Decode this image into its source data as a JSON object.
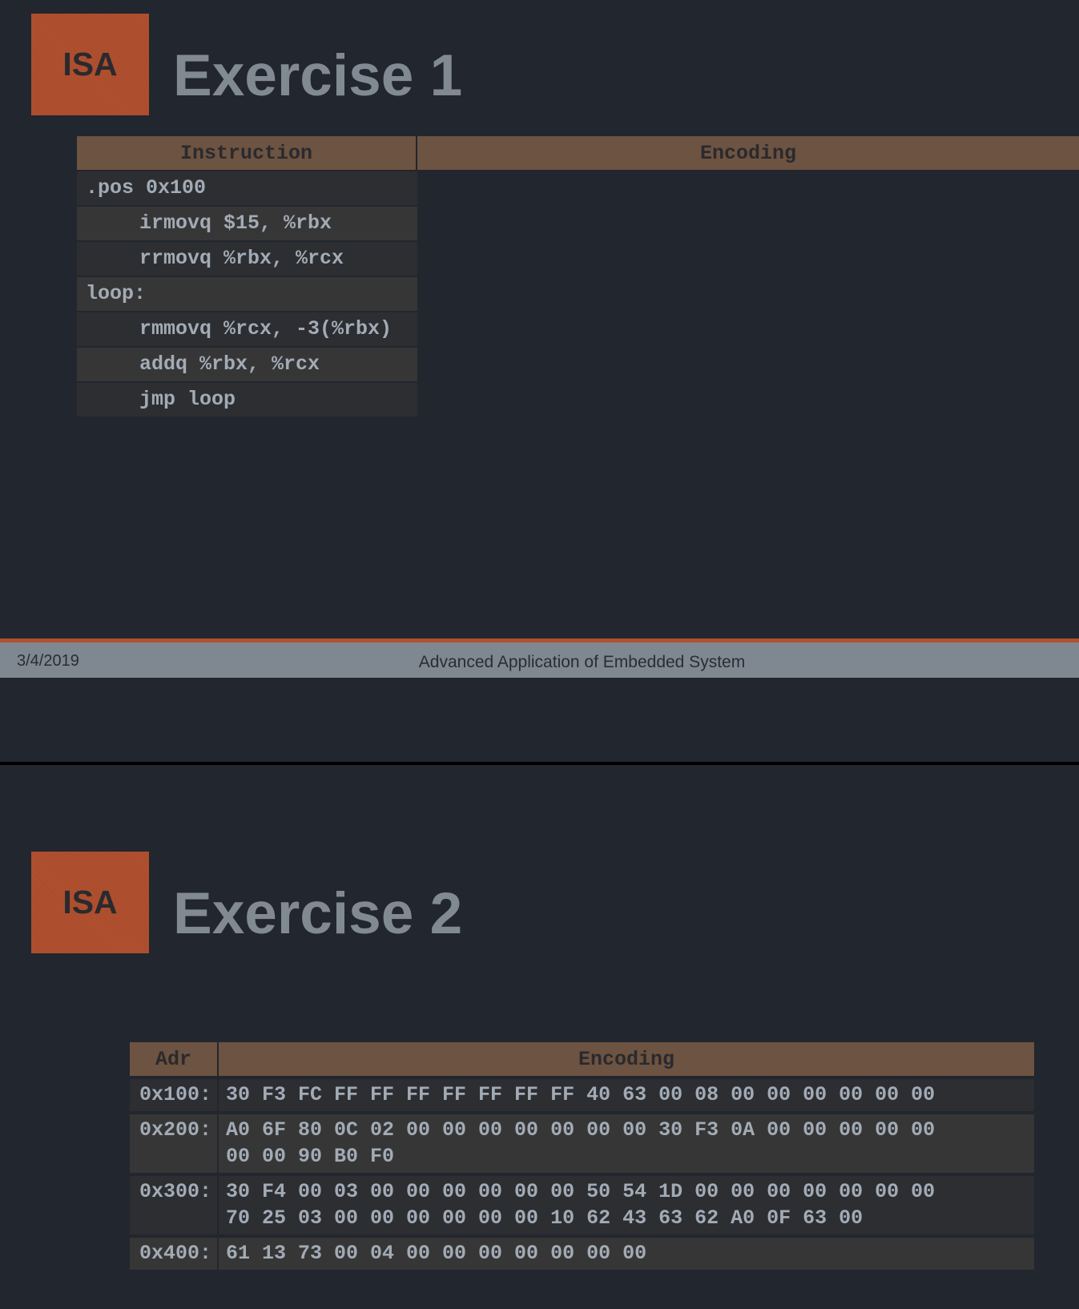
{
  "slide1": {
    "logo": "ISA",
    "title": "Exercise 1",
    "table": {
      "headers": [
        "Instruction",
        "Encoding"
      ],
      "rows": [
        {
          "instruction": ".pos 0x100",
          "encoding": ""
        },
        {
          "instruction": "irmovq $15, %rbx",
          "encoding": ""
        },
        {
          "instruction": "rrmovq %rbx, %rcx",
          "encoding": ""
        },
        {
          "instruction": "loop:",
          "encoding": ""
        },
        {
          "instruction": "rmmovq %rcx, -3(%rbx)",
          "encoding": ""
        },
        {
          "instruction": "addq %rbx, %rcx",
          "encoding": ""
        },
        {
          "instruction": "jmp loop",
          "encoding": ""
        }
      ]
    },
    "footer": {
      "date": "3/4/2019",
      "course": "Advanced Application of Embedded System"
    }
  },
  "slide2": {
    "logo": "ISA",
    "title": "Exercise 2",
    "table": {
      "headers": [
        "Adr",
        "Encoding"
      ],
      "rows": [
        {
          "adr": "0x100:",
          "encoding": "30 F3 FC FF FF FF FF FF FF FF 40 63 00 08 00 00 00 00 00 00"
        },
        {
          "adr": "0x200:",
          "encoding": "A0 6F 80 0C 02 00 00 00 00 00 00 00 30 F3 0A 00 00 00 00 00\n00 00 90 B0 F0"
        },
        {
          "adr": "0x300:",
          "encoding": "30 F4 00 03 00 00 00 00 00 00 50 54 1D 00 00 00 00 00 00 00\n70 25 03 00 00 00 00 00 00 10 62 43 63 62 A0 0F 63 00"
        },
        {
          "adr": "0x400:",
          "encoding": "61 13 73 00 04 00 00 00 00 00 00 00"
        }
      ]
    }
  }
}
